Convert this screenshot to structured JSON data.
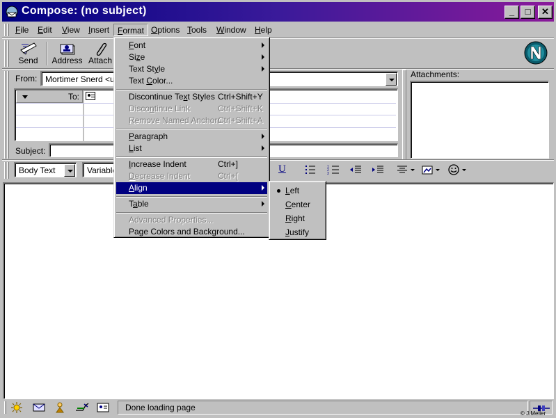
{
  "window": {
    "title": "Compose: (no subject)",
    "controls": {
      "minimize": "_",
      "maximize": "□",
      "close": "✕"
    }
  },
  "menubar": [
    {
      "label": "File",
      "u": "F",
      "rest": "ile"
    },
    {
      "label": "Edit",
      "u": "E",
      "rest": "dit"
    },
    {
      "label": "View",
      "u": "V",
      "rest": "iew"
    },
    {
      "label": "Insert",
      "u": "I",
      "rest": "nsert"
    },
    {
      "label": "Format",
      "u": "F",
      "rest": "ormat"
    },
    {
      "label": "Options",
      "u": "O",
      "rest": "ptions"
    },
    {
      "label": "Tools",
      "u": "T",
      "rest": "ools"
    },
    {
      "label": "Window",
      "u": "W",
      "rest": "indow"
    },
    {
      "label": "Help",
      "u": "H",
      "rest": "elp"
    }
  ],
  "toolbar": {
    "send": "Send",
    "address": "Address",
    "attach": "Attach"
  },
  "compose": {
    "from_label": "From:",
    "from_value": "Mortimer Snerd <use",
    "to_label": "To:",
    "subject_label": "Subject:",
    "attachments_label": "Attachments:"
  },
  "format_bar": {
    "paragraph_style": "Body Text",
    "font": "Variable"
  },
  "format_menu": {
    "font": "Font",
    "size": "Size",
    "text_style": "Text Style",
    "text_color": "Text Color...",
    "discontinue_text_styles": "Discontinue Text Styles",
    "discontinue_text_styles_sc": "Ctrl+Shift+Y",
    "discontinue_link": "Discontinue Link",
    "discontinue_link_sc": "Ctrl+Shift+K",
    "remove_named_anchors": "Remove Named Anchors",
    "remove_named_anchors_sc": "Ctrl+Shift+A",
    "paragraph": "Paragraph",
    "list": "List",
    "increase_indent": "Increase Indent",
    "increase_indent_sc": "Ctrl+]",
    "decrease_indent": "Decrease Indent",
    "decrease_indent_sc": "Ctrl+[",
    "align": "Align",
    "table": "Table",
    "advanced_properties": "Advanced Properties...",
    "page_colors": "Page Colors and Background..."
  },
  "align_submenu": {
    "left": "Left",
    "center": "Center",
    "right": "Right",
    "justify": "Justify"
  },
  "status": {
    "text": "Done loading page",
    "copyright": "© J.Meller"
  },
  "colors": {
    "title_start": "#000080",
    "title_end": "#8a1a9a",
    "highlight": "#000080",
    "face": "#c0c0c0"
  }
}
